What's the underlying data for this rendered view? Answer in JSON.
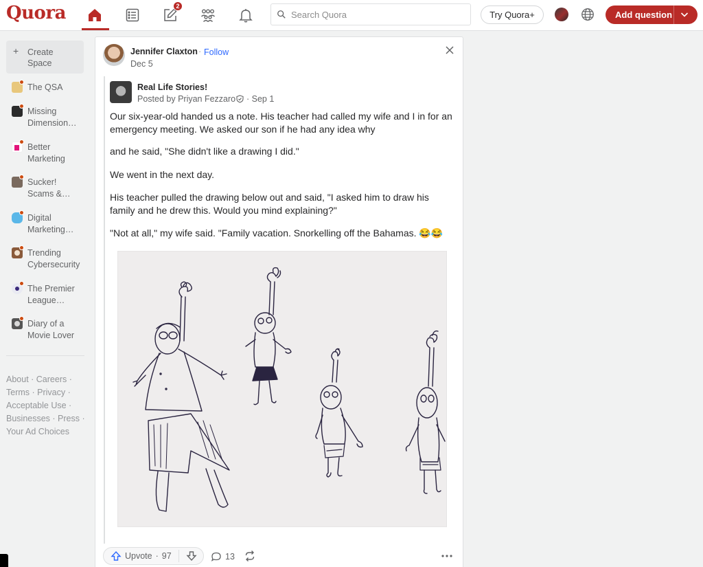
{
  "brand": {
    "logo_text": "Quora",
    "accent_color": "#b92b27",
    "link_color": "#2e69ff"
  },
  "header": {
    "nav": [
      {
        "name": "home",
        "icon": "home-icon",
        "active": true
      },
      {
        "name": "following",
        "icon": "list-icon"
      },
      {
        "name": "answer",
        "icon": "pencil-square-icon",
        "badge": "2"
      },
      {
        "name": "spaces",
        "icon": "people-group-icon"
      },
      {
        "name": "notifications",
        "icon": "bell-icon"
      }
    ],
    "search_placeholder": "Search Quora",
    "try_plus_label": "Try Quora+",
    "add_question_label": "Add question"
  },
  "sidebar": {
    "create_space_label": "Create Space",
    "spaces": [
      {
        "label": "The QSA",
        "icon_color": "#e8c77c"
      },
      {
        "label": "Missing Dimension…",
        "icon_color": "#2b2b2b"
      },
      {
        "label": "Better Marketing",
        "icon_color": "#e2147b"
      },
      {
        "label": "Sucker! Scams &…",
        "icon_color": "#7a6a5e"
      },
      {
        "label": "Digital Marketing…",
        "icon_color": "#5ab7e8"
      },
      {
        "label": "Trending Cybersecurity",
        "icon_color": "#8a5a3a"
      },
      {
        "label": "The Premier League…",
        "icon_color": "#e9eaf2"
      },
      {
        "label": "Diary of a Movie Lover",
        "icon_color": "#555555"
      }
    ],
    "footer_links": [
      "About",
      "Careers",
      "Terms",
      "Privacy",
      "Acceptable Use",
      "Businesses",
      "Press",
      "Your Ad Choices"
    ]
  },
  "post": {
    "author_name": "Jennifer Claxton",
    "dot": "·",
    "follow_label": "Follow",
    "date": "Dec 5",
    "shared": {
      "space_name": "Real Life Stories!",
      "posted_by": "Posted by Priyan Fezzaro",
      "posted_date": "· Sep 1"
    },
    "paragraphs": [
      "Our six-year-old handed us a note. His teacher had called my wife and I in for an emergency meeting. We asked our son if he had any idea why",
      "and he said, \"She didn't like a drawing I did.\"",
      "We went in the next day.",
      "His teacher pulled the drawing below out and said, \"I asked him to draw his family and he drew this. Would you mind explaining?\"",
      "\"Not at all,\" my wife said. \"Family vacation. Snorkelling off the Bahamas. 😂😂"
    ],
    "actions": {
      "upvote_label": "Upvote",
      "upvote_sep": "·",
      "upvote_count": "97",
      "comment_count": "13"
    }
  }
}
